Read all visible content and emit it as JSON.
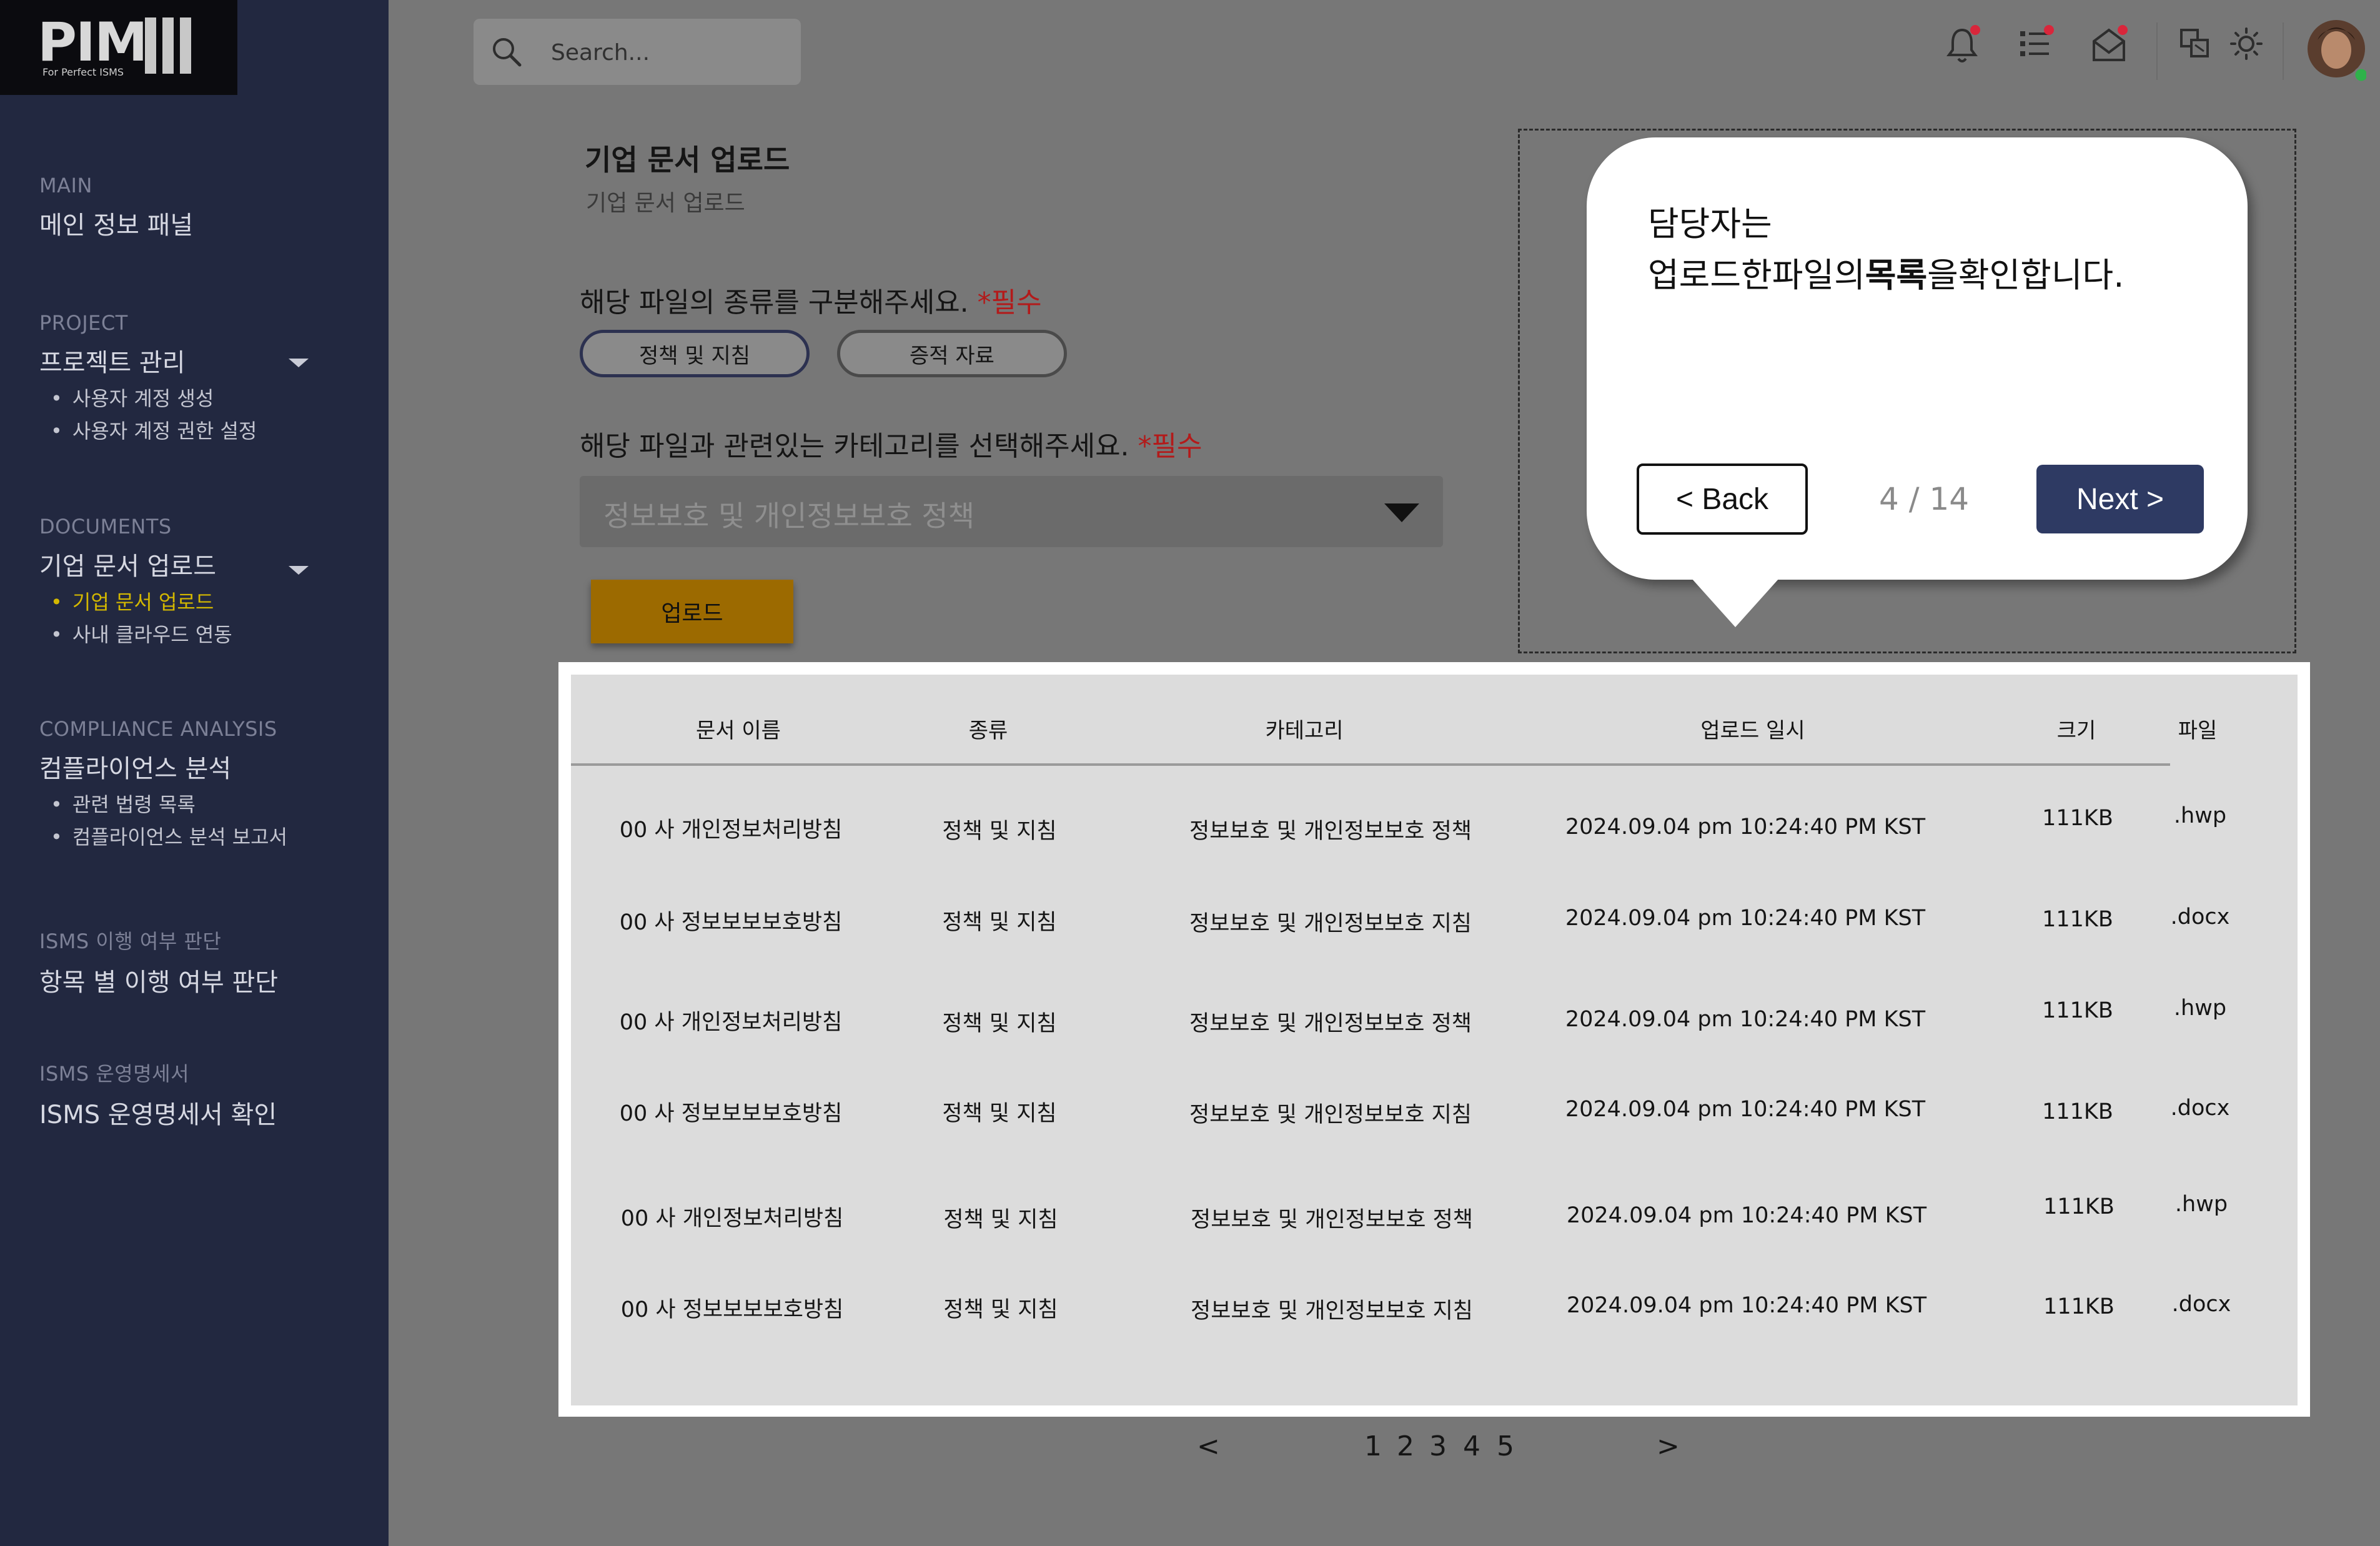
{
  "brand": {
    "logo_text": "PIM",
    "logo_sub": "For Perfect ISMS"
  },
  "search": {
    "placeholder": "Search..."
  },
  "sidebar": {
    "sections": [
      {
        "caption": "MAIN",
        "title": "메인 정보 패널",
        "items": []
      },
      {
        "caption": "PROJECT",
        "title": "프로젝트 관리",
        "items": [
          "사용자 계정 생성",
          "사용자 계정 권한 설정"
        ]
      },
      {
        "caption": "DOCUMENTS",
        "title": "기업 문서 업로드",
        "items": [
          "기업 문서 업로드",
          "사내 클라우드 연동"
        ]
      },
      {
        "caption": "COMPLIANCE ANALYSIS",
        "title": "컴플라이언스 분석",
        "items": [
          "관련 법령 목록",
          "컴플라이언스 분석 보고서"
        ]
      },
      {
        "caption": "ISMS 이행 여부 판단",
        "title": "항목 별 이행 여부 판단",
        "items": []
      },
      {
        "caption": "ISMS 운영명세서",
        "title": "ISMS 운영명세서 확인",
        "items": []
      }
    ],
    "active_item": "기업 문서 업로드",
    "bullet": "•"
  },
  "page": {
    "title": "기업 문서 업로드",
    "subtitle": "기업 문서 업로드"
  },
  "form": {
    "type_question": "해당 파일의 종류를 구분해주세요.",
    "required_mark": "*필수",
    "type_options": [
      "정책 및 지침",
      "증적 자료"
    ],
    "category_question": "해당 파일과 관련있는 카테고리를 선택해주세요.",
    "category_value": "정보보호 및 개인정보보호 정책",
    "upload_label": "업로드"
  },
  "table": {
    "columns": [
      "문서 이름",
      "종류",
      "카테고리",
      "업로드 일시",
      "크기",
      "파일"
    ],
    "rows": [
      [
        "00 사 개인정보처리방침",
        "정책 및 지침",
        "정보보호 및 개인정보보호 정책",
        "2024.09.04 pm 10:24:40 PM KST",
        "111KB",
        ".hwp"
      ],
      [
        "00 사 정보보보보호방침",
        "정책 및 지침",
        "정보보호 및 개인정보보호 지침",
        "2024.09.04 pm 10:24:40 PM KST",
        "111KB",
        ".docx"
      ],
      [
        "00 사 개인정보처리방침",
        "정책 및 지침",
        "정보보호 및 개인정보보호 정책",
        "2024.09.04 pm 10:24:40 PM KST",
        "111KB",
        ".hwp"
      ],
      [
        "00 사 정보보보보호방침",
        "정책 및 지침",
        "정보보호 및 개인정보보호 지침",
        "2024.09.04 pm 10:24:40 PM KST",
        "111KB",
        ".docx"
      ],
      [
        "00 사 개인정보처리방침",
        "정책 및 지침",
        "정보보호 및 개인정보보호 정책",
        "2024.09.04 pm 10:24:40 PM KST",
        "111KB",
        ".hwp"
      ],
      [
        "00 사 정보보보보호방침",
        "정책 및 지침",
        "정보보호 및 개인정보보호 지침",
        "2024.09.04 pm 10:24:40 PM KST",
        "111KB",
        ".docx"
      ]
    ]
  },
  "pagination": {
    "prev": "<",
    "pages": [
      "1",
      "2",
      "3",
      "4",
      "5"
    ],
    "next": ">"
  },
  "tooltip": {
    "line1": "담당자는",
    "line2_before": "업로드한파일의",
    "line2_bold": "목록",
    "line2_after": "을확인합니다.",
    "back_label": "< Back",
    "step": "4 / 14",
    "next_label": "Next >"
  },
  "colors": {
    "sidebar": "#222840",
    "accent_active": "#d4b800",
    "required": "#b31a1a",
    "upload_button": "#9c6a00",
    "next_button": "#2e3a63",
    "notification_dot": "#d9263b"
  },
  "icons": [
    "search-icon",
    "bell-icon",
    "list-icon",
    "mail-icon",
    "translate-icon",
    "sun-icon"
  ]
}
